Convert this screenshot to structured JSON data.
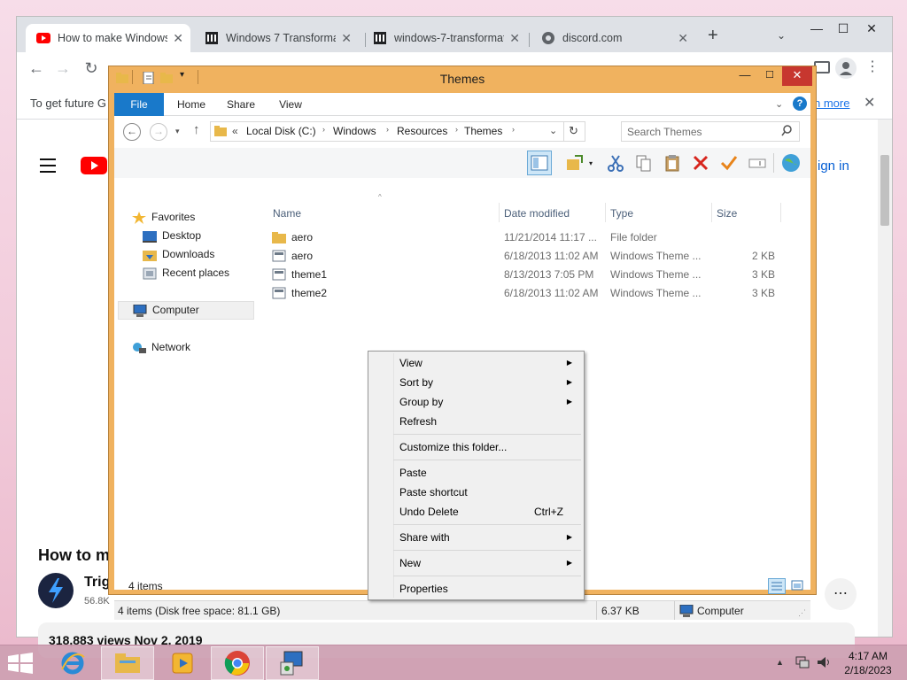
{
  "browser": {
    "tabs": [
      {
        "title": "How to make Windows"
      },
      {
        "title": "Windows 7 Transformat"
      },
      {
        "title": "windows-7-transformat"
      },
      {
        "title": "discord.com"
      }
    ],
    "new_tab": "+",
    "address": "...",
    "infobar_text": "To get future G",
    "infobar_link": "n more",
    "sign_in": "ign in",
    "video_title": "How to m",
    "channel_name": "Trig",
    "channel_subs": "56.8K",
    "views_date": "318,883 views  Nov 2, 2019"
  },
  "explorer": {
    "title": "Themes",
    "ribbon_tabs": [
      "File",
      "Home",
      "Share",
      "View"
    ],
    "breadcrumb": {
      "chev": "«",
      "parts": [
        "Local Disk (C:)",
        "Windows",
        "Resources",
        "Themes"
      ]
    },
    "search_placeholder": "Search Themes",
    "nav": {
      "favorites": "Favorites",
      "desktop": "Desktop",
      "downloads": "Downloads",
      "recent": "Recent places",
      "computer": "Computer",
      "network": "Network"
    },
    "columns": {
      "name": "Name",
      "date": "Date modified",
      "type": "Type",
      "size": "Size"
    },
    "files": [
      {
        "name": "aero",
        "date": "11/21/2014 11:17 ...",
        "type": "File folder",
        "size": ""
      },
      {
        "name": "aero",
        "date": "6/18/2013 11:02 AM",
        "type": "Windows Theme ...",
        "size": "2 KB"
      },
      {
        "name": "theme1",
        "date": "8/13/2013 7:05 PM",
        "type": "Windows Theme ...",
        "size": "3 KB"
      },
      {
        "name": "theme2",
        "date": "6/18/2013 11:02 AM",
        "type": "Windows Theme ...",
        "size": "3 KB"
      }
    ],
    "item_count": "4 items",
    "status_left": "4 items (Disk free space: 81.1 GB)",
    "status_size": "6.37 KB",
    "status_location": "Computer"
  },
  "context_menu": {
    "view": "View",
    "sort_by": "Sort by",
    "group_by": "Group by",
    "refresh": "Refresh",
    "customize": "Customize this folder...",
    "paste": "Paste",
    "paste_shortcut": "Paste shortcut",
    "undo_delete": "Undo Delete",
    "undo_shortcut": "Ctrl+Z",
    "share_with": "Share with",
    "new": "New",
    "properties": "Properties"
  },
  "taskbar": {
    "time": "4:17 AM",
    "date": "2/18/2023"
  },
  "colors": {
    "explorer_frame": "#f0b25f",
    "close_red": "#c7372f",
    "file_tab": "#1979ca",
    "taskbar": "#cda0b2"
  }
}
